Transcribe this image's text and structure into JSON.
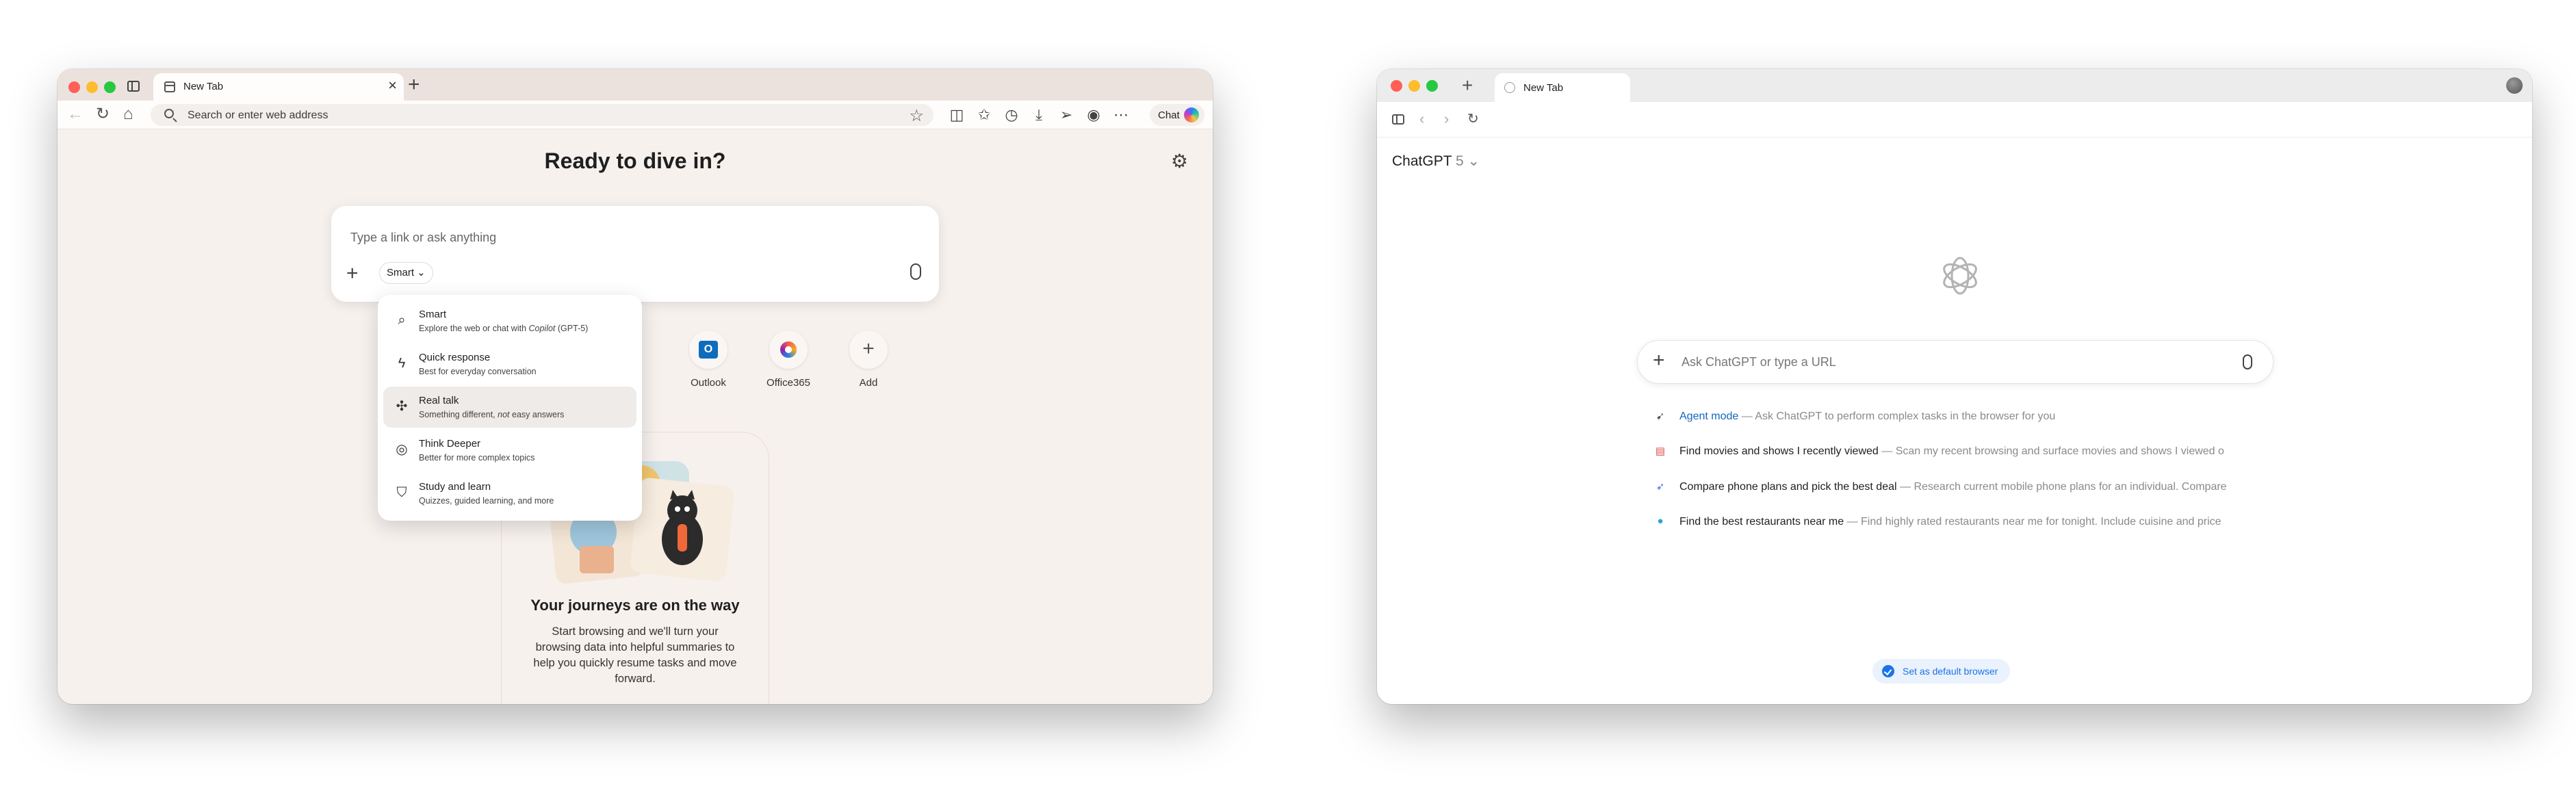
{
  "edge": {
    "tab_title": "New Tab",
    "tab_close": "×",
    "new_tab": "+",
    "address_placeholder": "Search or enter web address",
    "chat_label": "Chat",
    "heading": "Ready to dive in?",
    "search_placeholder": "Type a link or ask anything",
    "mode_label": "Smart",
    "mode_menu": [
      {
        "title": "Smart",
        "desc_pre": "Explore the web or chat with ",
        "desc_em": "Copilot",
        "desc_post": " (GPT-5)",
        "icon": "search-icon"
      },
      {
        "title": "Quick response",
        "desc": "Best for everyday conversation",
        "icon": "lightning-icon"
      },
      {
        "title": "Real talk",
        "desc_pre": "Something different, ",
        "desc_em": "not",
        "desc_post": " easy answers",
        "icon": "real-talk-icon",
        "highlighted": true
      },
      {
        "title": "Think Deeper",
        "desc": "Better for more complex topics",
        "icon": "think-deeper-icon"
      },
      {
        "title": "Study and learn",
        "desc": "Quizzes, guided learning, and more",
        "icon": "graduation-cap-icon"
      }
    ],
    "shortcuts": [
      {
        "label": "Outlook",
        "icon": "outlook-icon"
      },
      {
        "label": "Office365",
        "icon": "office365-icon"
      },
      {
        "label": "Add",
        "icon": "plus-icon"
      }
    ],
    "journey_title": "Your journeys are on the way",
    "journey_desc": "Start browsing and we'll turn your browsing data into helpful summaries to help you quickly resume tasks and move forward."
  },
  "atlas": {
    "tab_title": "New Tab",
    "new_tab": "+",
    "model_name": "ChatGPT",
    "model_version": "5",
    "ask_placeholder": "Ask ChatGPT or type a URL",
    "suggestions": [
      {
        "head": "Agent mode",
        "rest": " — Ask ChatGPT to perform complex tasks in the browser for you",
        "icon": "agent-icon",
        "accent": true
      },
      {
        "head": "Find movies and shows I recently viewed",
        "rest": " — Scan my recent browsing and surface movies and shows I viewed o",
        "icon": "film-icon"
      },
      {
        "head": "Compare phone plans and pick the best deal",
        "rest": " — Research current mobile phone plans for an individual. Compare",
        "icon": "rocket-icon"
      },
      {
        "head": "Find the best restaurants near me",
        "rest": " — Find highly rated restaurants near me for tonight. Include cuisine and price",
        "icon": "globe-icon"
      }
    ],
    "default_browser": "Set as default browser"
  }
}
